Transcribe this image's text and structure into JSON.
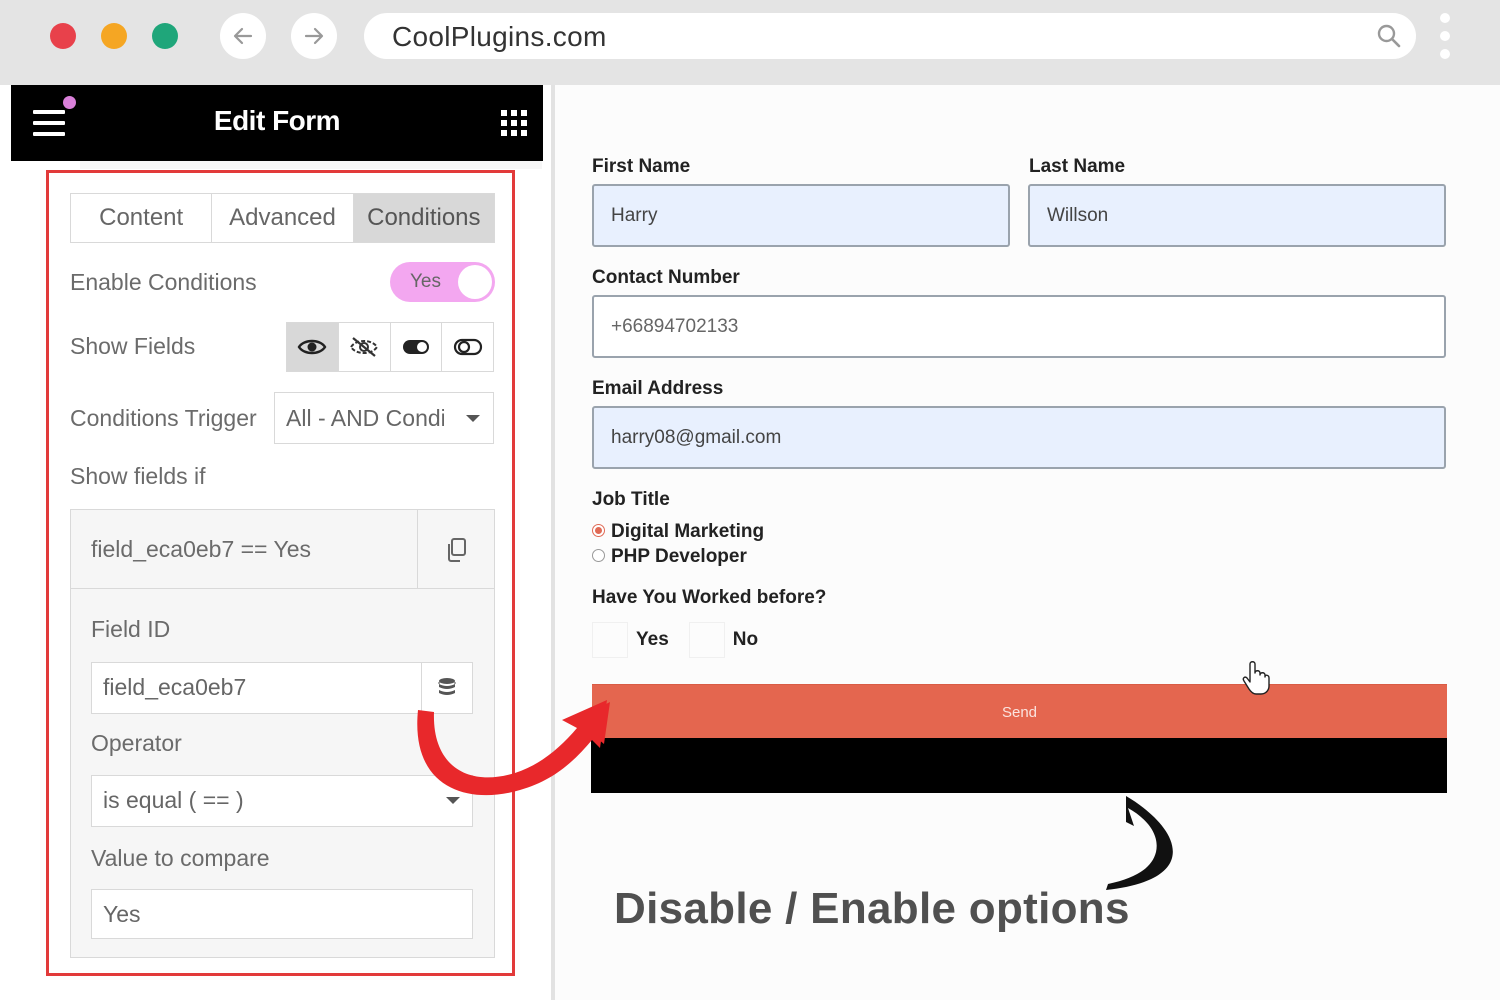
{
  "browser": {
    "url": "CoolPlugins.com"
  },
  "editor": {
    "title": "Edit Form",
    "tabs": [
      {
        "label": "Content"
      },
      {
        "label": "Advanced"
      },
      {
        "label": "Conditions"
      }
    ],
    "active_tab": "Conditions",
    "enable_conditions_label": "Enable Conditions",
    "enable_conditions_value": "Yes",
    "show_fields_label": "Show Fields",
    "show_fields_options": [
      "eye-icon",
      "eye-slash-icon",
      "toggle-on-icon",
      "toggle-off-icon"
    ],
    "conditions_trigger_label": "Conditions Trigger",
    "conditions_trigger_value": "All - AND Conditi",
    "show_fields_if_label": "Show fields if",
    "condition_summary": "field_eca0eb7 == Yes",
    "field_id_label": "Field ID",
    "field_id_value": "field_eca0eb7",
    "operator_label": "Operator",
    "operator_value": "is equal ( == )",
    "value_to_compare_label": "Value to compare",
    "value_to_compare_value": "Yes"
  },
  "form": {
    "first_name_label": "First Name",
    "first_name_value": "Harry",
    "last_name_label": "Last Name",
    "last_name_value": "Willson",
    "contact_label": "Contact Number",
    "contact_value": "+66894702133",
    "email_label": "Email Address",
    "email_value": "harry08@gmail.com",
    "job_title_label": "Job Title",
    "job_options": [
      {
        "label": "Digital Marketing",
        "checked": true
      },
      {
        "label": "PHP Developer",
        "checked": false
      }
    ],
    "worked_before_label": "Have You Worked before?",
    "worked_options": [
      {
        "label": "Yes"
      },
      {
        "label": "No"
      }
    ],
    "send_label": "Send"
  },
  "caption": "Disable / Enable options",
  "colors": {
    "frame_red": "#e23a3a",
    "toggle_pink": "#f3a7f0",
    "send_button": "#e4664f",
    "input_filled": "#e8f0fe"
  }
}
